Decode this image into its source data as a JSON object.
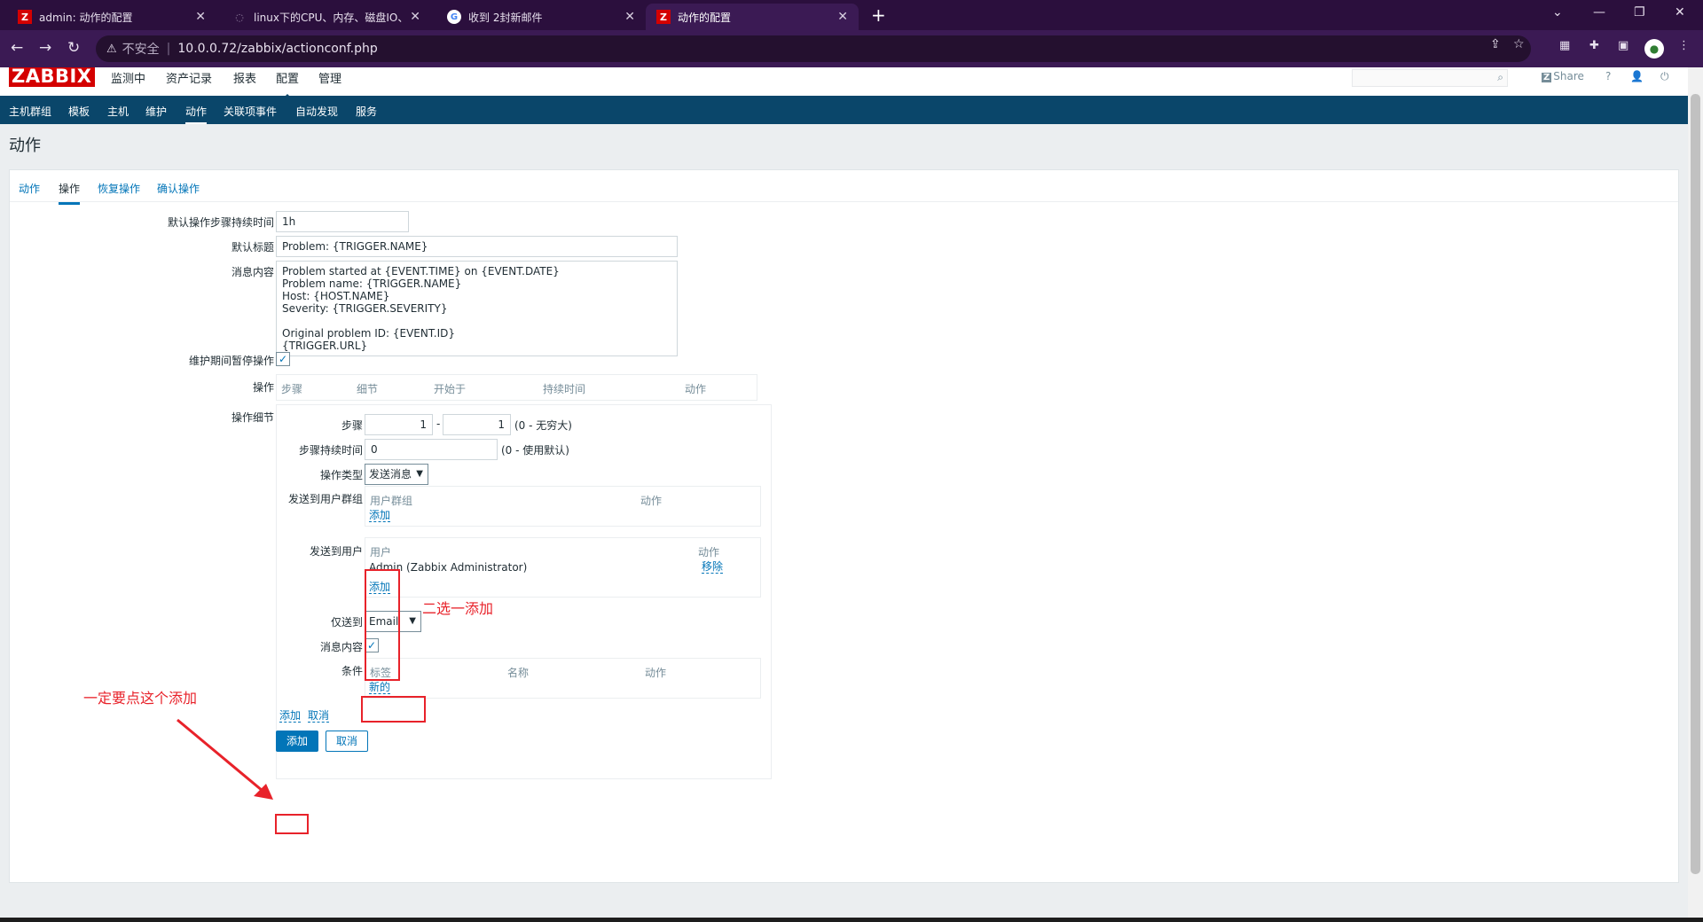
{
  "browser": {
    "tabs": [
      {
        "title": "admin: 动作的配置",
        "favicon": "zabbix-icon",
        "active": false
      },
      {
        "title": "linux下的CPU、内存、磁盘IO、",
        "favicon": "document-icon",
        "active": false
      },
      {
        "title": "收到 2封新邮件",
        "favicon": "google-icon",
        "active": false
      },
      {
        "title": "动作的配置",
        "favicon": "zabbix-icon",
        "active": true
      }
    ],
    "insecure_label": "不安全",
    "url": "10.0.0.72/zabbix/actionconf.php"
  },
  "header": {
    "logo": "ZABBIX",
    "menu": [
      "监测中",
      "资产记录",
      "报表",
      "配置",
      "管理"
    ],
    "active_menu": "配置",
    "share": "Share",
    "help": "?"
  },
  "subnav": {
    "items": [
      "主机群组",
      "模板",
      "主机",
      "维护",
      "动作",
      "关联项事件",
      "自动发现",
      "服务"
    ],
    "active": "动作"
  },
  "page_title": "动作",
  "tabs": [
    "动作",
    "操作",
    "恢复操作",
    "确认操作"
  ],
  "active_tab": "操作",
  "form": {
    "default_step_duration_label": "默认操作步骤持续时间",
    "default_step_duration": "1h",
    "default_subject_label": "默认标题",
    "default_subject": "Problem: {TRIGGER.NAME}",
    "default_message_label": "消息内容",
    "default_message": "Problem started at {EVENT.TIME} on {EVENT.DATE}\nProblem name: {TRIGGER.NAME}\nHost: {HOST.NAME}\nSeverity: {TRIGGER.SEVERITY}\n\nOriginal problem ID: {EVENT.ID}\n{TRIGGER.URL}",
    "pause_maintenance_label": "维护期间暂停操作",
    "operations_label": "操作",
    "operations_headers": [
      "步骤",
      "细节",
      "开始于",
      "持续时间",
      "动作"
    ],
    "details_label": "操作细节",
    "details": {
      "steps_label": "步骤",
      "step_from": "1",
      "step_sep": "-",
      "step_to": "1",
      "steps_hint": "(0 - 无穷大)",
      "step_duration_label": "步骤持续时间",
      "step_duration": "0",
      "step_duration_hint": "(0 - 使用默认)",
      "op_type_label": "操作类型",
      "op_type": "发送消息",
      "send_groups_label": "发送到用户群组",
      "groups_headers": [
        "用户群组",
        "动作"
      ],
      "groups_add": "添加",
      "send_users_label": "发送到用户",
      "users_headers": [
        "用户",
        "动作"
      ],
      "users": [
        {
          "name": "Admin (Zabbix Administrator)",
          "action": "移除"
        }
      ],
      "users_add": "添加",
      "send_only_label": "仅送到",
      "send_only": "Email",
      "default_msg_label": "消息内容",
      "conditions_label": "条件",
      "conditions_headers": [
        "标签",
        "名称",
        "动作"
      ],
      "conditions_new": "新的",
      "add_link": "添加",
      "cancel_link": "取消"
    },
    "submit": "添加",
    "cancel": "取消"
  },
  "annotations": {
    "choose_one": "二选一添加",
    "must_click": "一定要点这个添加"
  }
}
